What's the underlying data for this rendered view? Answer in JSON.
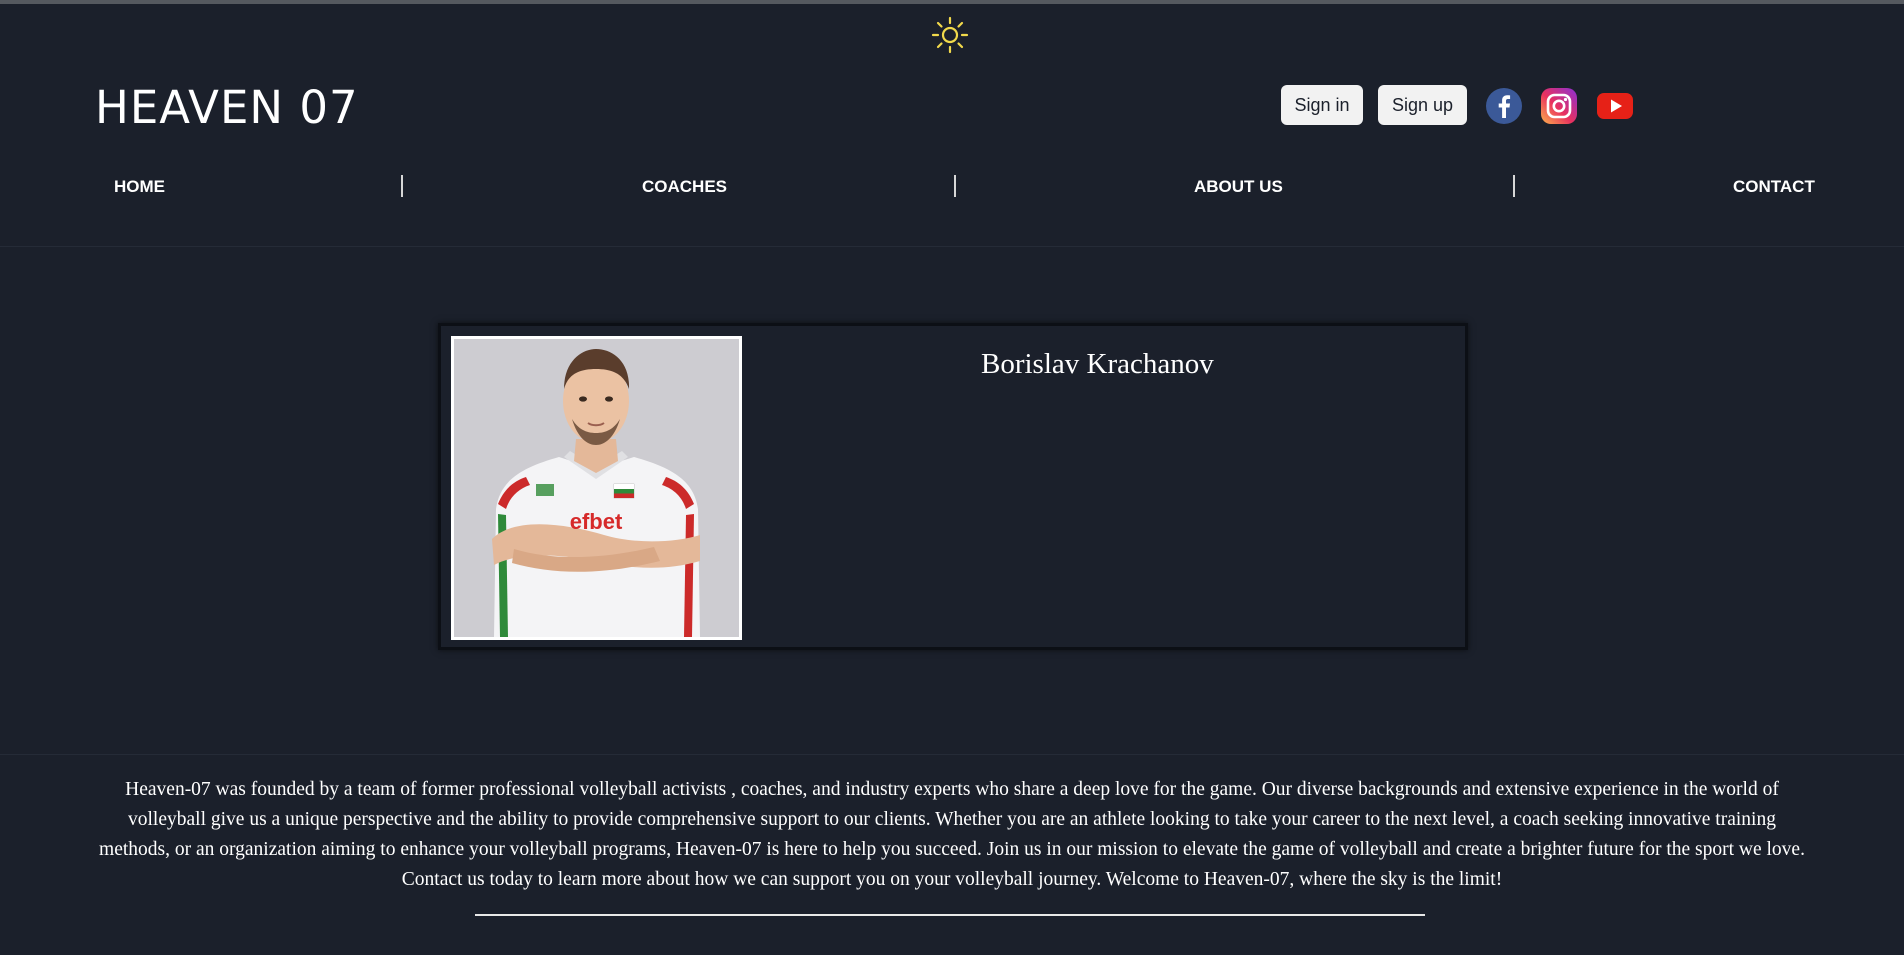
{
  "header": {
    "brand": "HEAVEN 07",
    "sign_in_label": "Sign in",
    "sign_up_label": "Sign up",
    "theme_icon": "sun-icon",
    "social_icons": [
      "facebook-icon",
      "instagram-icon",
      "youtube-icon"
    ]
  },
  "nav": {
    "items": [
      {
        "label": "HOME"
      },
      {
        "label": "COACHES"
      },
      {
        "label": "ABOUT US"
      },
      {
        "label": "CONTACT"
      }
    ]
  },
  "coach": {
    "name": "Borislav Krachanov",
    "jersey_text": "efbet"
  },
  "footer": {
    "about": "Heaven-07 was founded by a team of former professional volleyball activists , coaches, and industry experts who share a deep love for the game. Our diverse backgrounds and extensive experience in the world of volleyball give us a unique perspective and the ability to provide comprehensive support to our clients. Whether you are an athlete looking to take your career to the next level, a coach seeking innovative training methods, or an organization aiming to enhance your volleyball programs, Heaven-07 is here to help you succeed. Join us in our mission to elevate the game of volleyball and create a brighter future for the sport we love. Contact us today to learn more about how we can support you on your volleyball journey. Welcome to Heaven-07, where the sky is the limit!"
  },
  "colors": {
    "background": "#1b202b",
    "sun": "#f1d94b",
    "facebook": "#3b5998",
    "youtube": "#e62117"
  }
}
